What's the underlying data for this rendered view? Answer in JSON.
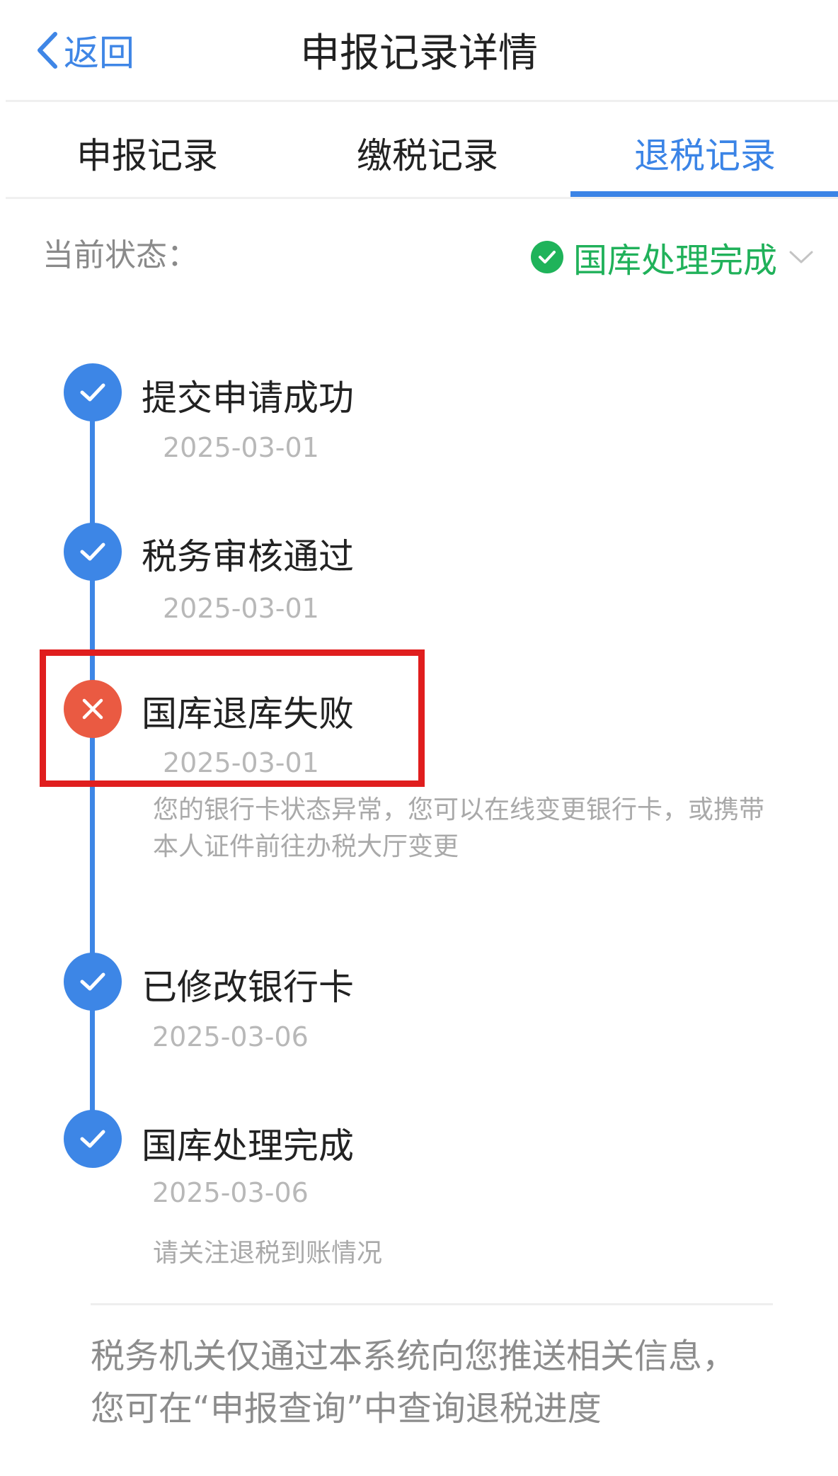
{
  "header": {
    "back_label": "返回",
    "title": "申报记录详情"
  },
  "tabs": [
    {
      "label": "申报记录",
      "active": false
    },
    {
      "label": "缴税记录",
      "active": false
    },
    {
      "label": "退税记录",
      "active": true
    }
  ],
  "status": {
    "label": "当前状态：",
    "value": "国库处理完成",
    "icon": "check-circle-icon",
    "color": "#1fb35a"
  },
  "timeline": [
    {
      "title": "提交申请成功",
      "date": "2025-03-01",
      "state": "done"
    },
    {
      "title": "税务审核通过",
      "date": "2025-03-01",
      "state": "done"
    },
    {
      "title": "国库退库失败",
      "date": "2025-03-01",
      "state": "failed",
      "note": "您的银行卡状态异常，您可以在线变更银行卡，或携带本人证件前往办税大厅变更"
    },
    {
      "title": "已修改银行卡",
      "date": "2025-03-06",
      "state": "done"
    },
    {
      "title": "国库处理完成",
      "date": "2025-03-06",
      "state": "done",
      "note": "请关注退税到账情况"
    }
  ],
  "footer": {
    "line1": "税务机关仅通过本系统向您推送相关信息，",
    "line2": "您可在“申报查询”中查询退税进度"
  },
  "colors": {
    "accent": "#3b84e6",
    "success": "#1fb35a",
    "error": "#ea5a42",
    "highlight": "#e01e1e"
  }
}
